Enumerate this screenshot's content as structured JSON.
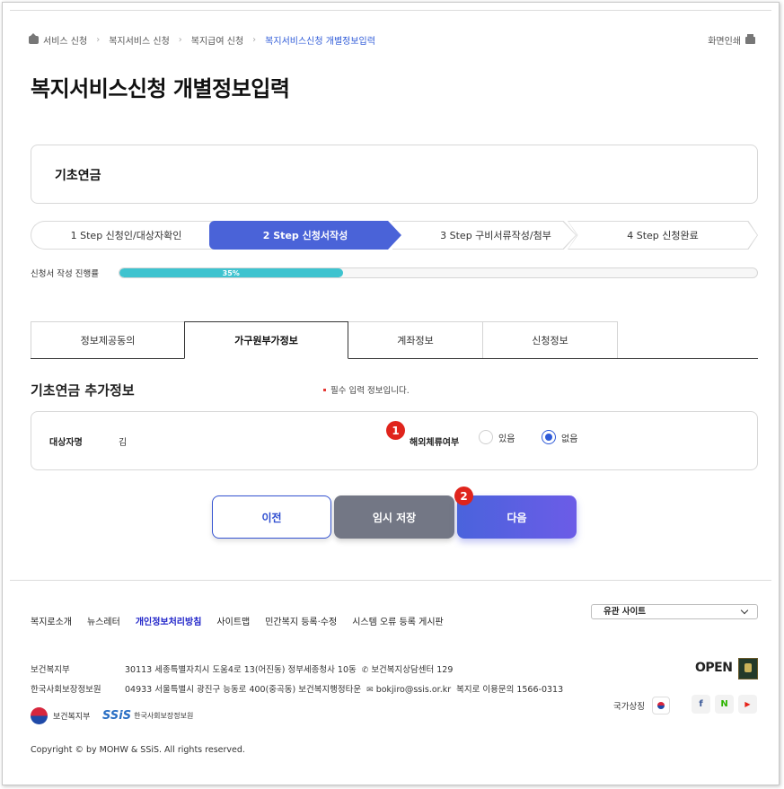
{
  "breadcrumb": {
    "items": [
      "서비스 신청",
      "복지서비스 신청",
      "복지급여 신청",
      "복지서비스신청 개별정보입력"
    ]
  },
  "header": {
    "print_label": "화면인쇄",
    "page_title": "복지서비스신청 개별정보입력"
  },
  "service": {
    "name": "기초연금"
  },
  "steps": [
    {
      "label": "1 Step 신청인/대상자확인"
    },
    {
      "label": "2 Step 신청서작성",
      "active": true
    },
    {
      "label": "3 Step 구비서류작성/첨부"
    },
    {
      "label": "4 Step 신청완료"
    }
  ],
  "progress": {
    "label": "신청서 작성 진행률",
    "value_text": "35%",
    "value": 35
  },
  "tabs": [
    {
      "label": "정보제공동의"
    },
    {
      "label": "가구원부가정보",
      "active": true
    },
    {
      "label": "계좌정보"
    },
    {
      "label": "신청정보"
    }
  ],
  "section": {
    "title": "기초연금 추가정보",
    "required_note": "필수 입력 정보입니다."
  },
  "form": {
    "target_name_label": "대상자명",
    "target_name_value": "김",
    "overseas_label": "해외체류여부",
    "option_yes": "있음",
    "option_no": "없음",
    "selected": "없음"
  },
  "annotations": {
    "badge1": "1",
    "badge2": "2"
  },
  "buttons": {
    "prev": "이전",
    "temp_save": "임시 저장",
    "next": "다음"
  },
  "footer": {
    "links": [
      "복지로소개",
      "뉴스레터",
      "개인정보처리방침",
      "사이트맵",
      "민간복지 등록·수정",
      "시스템 오류 등록 게시판"
    ],
    "related_sites": "유관 사이트",
    "org1": "보건복지부",
    "org1_address": "30113  세종특별자치시 도움4로 13(어진동) 정부세종청사 10동",
    "org1_contact": "보건복지상담센터 129",
    "org2": "한국사회보장정보원",
    "org2_address": "04933 서울특별시 광진구 능동로 400(중곡동) 보건복지행정타운",
    "org2_email": "bokjiro@ssis.or.kr",
    "org2_inquiry": "복지로 이용문의 1566-0313",
    "logo1_text": "보건복지부",
    "logo2_mark": "SSiS",
    "logo2_text": "한국사회보장정보원",
    "copyright": "Copyright © by MOHW & SSiS. All rights reserved.",
    "open_logo": "OPEN",
    "national_symbol": "국가상징",
    "sns": [
      "f",
      "N",
      "▶"
    ]
  },
  "colors": {
    "accent": "#4a63d8",
    "progress": "#3ec3cf",
    "badge": "#e0241c",
    "link_highlight": "#2024c9"
  }
}
